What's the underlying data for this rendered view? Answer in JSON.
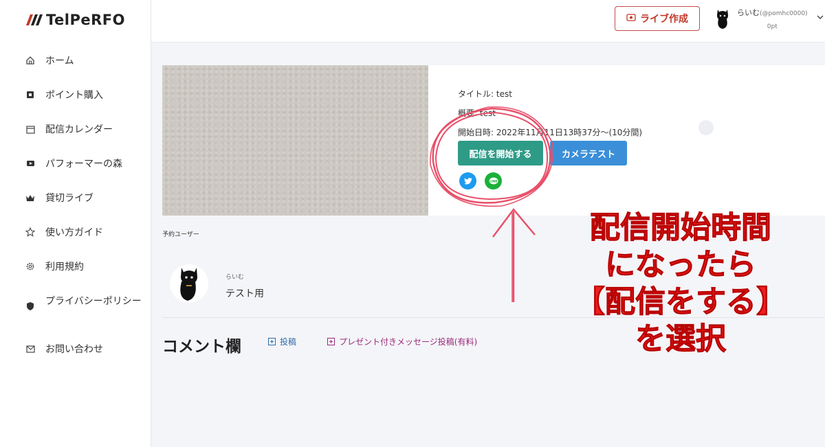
{
  "app": {
    "brand": "TelPeRFO",
    "brand_color": "#222222",
    "accent_red": "#c0392b"
  },
  "sidebar": {
    "items": [
      {
        "label": "ホーム",
        "icon": "home-icon"
      },
      {
        "label": "ポイント購入",
        "icon": "points-icon"
      },
      {
        "label": "配信カレンダー",
        "icon": "calendar-icon"
      },
      {
        "label": "パフォーマーの森",
        "icon": "video-icon"
      },
      {
        "label": "貸切ライブ",
        "icon": "crown-icon"
      },
      {
        "label": "使い方ガイド",
        "icon": "star-icon"
      },
      {
        "label": "利用規約",
        "icon": "gear-icon"
      },
      {
        "label": "プライバシーポリシー",
        "icon": "shield-icon"
      },
      {
        "label": "お問い合わせ",
        "icon": "mail-icon"
      }
    ]
  },
  "header": {
    "live_button": "ライブ作成",
    "user_name": "らいむ",
    "user_handle": "(@pomhc0000)",
    "user_points": "0pt"
  },
  "stream": {
    "title_line": "タイトル: test",
    "summary_line": "概要: test",
    "datetime_line": "開始日時: 2022年11月11日13時37分〜(10分間)",
    "start_button": "配信を開始する",
    "camera_button": "カメラテスト",
    "start_color": "#2e9b87",
    "camera_color": "#3a8fd8"
  },
  "reserved": {
    "label": "予約ユーザー",
    "user_name": "らいむ",
    "note": "テスト用"
  },
  "comments": {
    "title": "コメント欄",
    "post_link": "投稿",
    "present_link": "プレゼント付きメッセージ投稿(有料)"
  },
  "annotation": {
    "lines": [
      "配信開始時間",
      "になったら",
      "【配信をする】",
      "を選択"
    ],
    "color": "#ef1f1f"
  }
}
